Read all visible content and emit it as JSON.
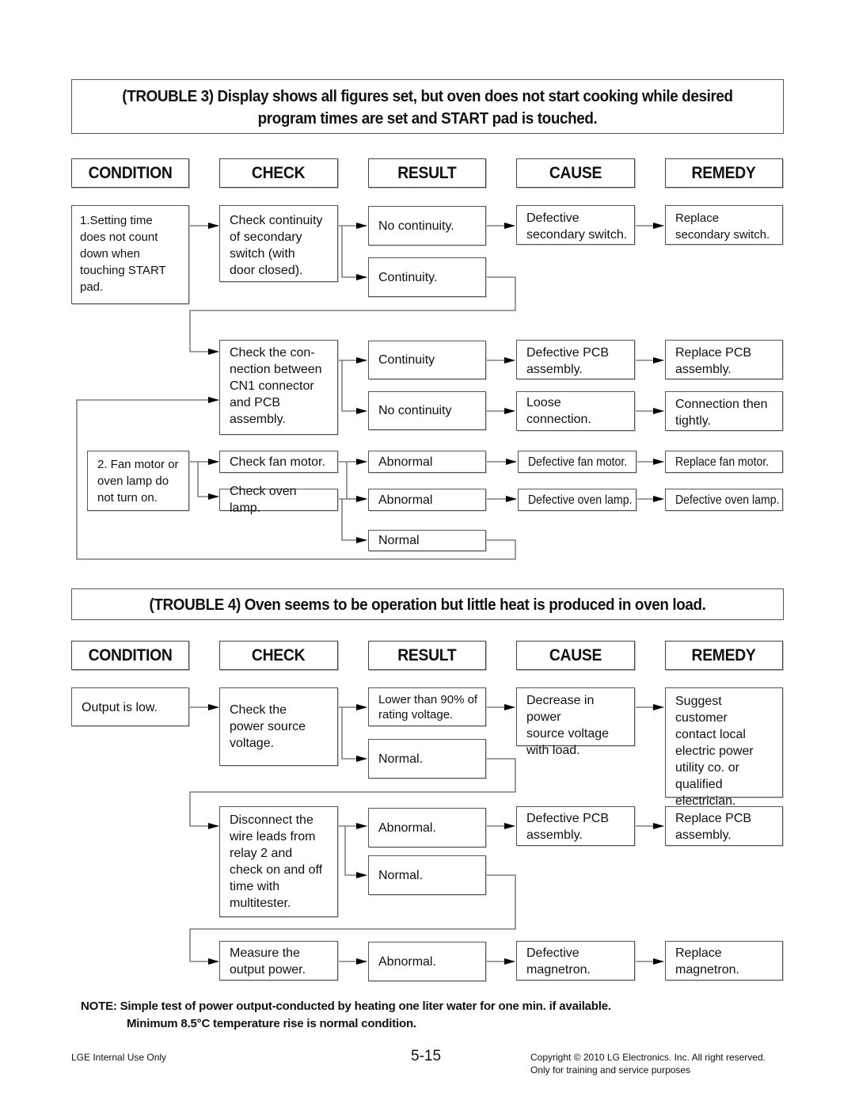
{
  "trouble3": {
    "title_line1": "(TROUBLE 3) Display shows all figures set, but oven does not start cooking while desired",
    "title_line2": "program times are set and START pad is touched.",
    "headers": [
      "CONDITION",
      "CHECK",
      "RESULT",
      "CAUSE",
      "REMEDY"
    ],
    "conditions": [
      "1.Setting time\n  does not count\n  down when\n  touching START\n  pad.",
      "2. Fan motor or\n    oven lamp do\n    not turn on."
    ],
    "checks": [
      "Check continuity\nof secondary\nswitch (with\ndoor closed).",
      "Check the con-\nnection between\nCN1 connector\nand PCB\nassembly.",
      "Check fan motor.",
      "Check oven lamp."
    ],
    "results": [
      "No continuity.",
      "Continuity.",
      "Continuity",
      "No continuity",
      "Abnormal",
      "Abnormal",
      "Normal"
    ],
    "causes": [
      "Defective\nsecondary switch.",
      "Defective PCB\nassembly.",
      "Loose connection.",
      "Defective fan motor.",
      "Defective oven lamp."
    ],
    "remedies": [
      "Replace\nsecondary switch.",
      "Replace PCB\nassembly.",
      "Connection then\ntightly.",
      "Replace fan motor.",
      "Defective oven lamp."
    ]
  },
  "trouble4": {
    "title": "(TROUBLE 4) Oven seems to be operation but little heat is produced in oven load.",
    "headers": [
      "CONDITION",
      "CHECK",
      "RESULT",
      "CAUSE",
      "REMEDY"
    ],
    "conditions": [
      "Output is low."
    ],
    "checks": [
      "Check the\npower source\nvoltage.",
      "Disconnect the\nwire leads from\nrelay 2 and\ncheck on and off\ntime with\nmultitester.",
      "Measure the\noutput power."
    ],
    "results": [
      "Lower than 90% of\nrating voltage.",
      "Normal.",
      "Abnormal.",
      "Normal.",
      "Abnormal."
    ],
    "causes": [
      "Decrease in power\nsource voltage\nwith load.",
      "Defective PCB\nassembly.",
      "Defective\nmagnetron."
    ],
    "remedies": [
      "Suggest customer\ncontact local\nelectric power\nutility co. or\nqualified\nelectrician.",
      "Replace PCB\nassembly.",
      "Replace\nmagnetron."
    ]
  },
  "note": {
    "line1": "NOTE: Simple test of power output-conducted by heating one liter water for one min. if available.",
    "line2": "Minimum 8.5°C temperature rise is normal condition."
  },
  "footer": {
    "left": "LGE Internal Use Only",
    "page_number": "5-15",
    "copyright": "Copyright © 2010 LG Electronics. Inc. All right reserved.",
    "training": "Only for training and service purposes"
  }
}
